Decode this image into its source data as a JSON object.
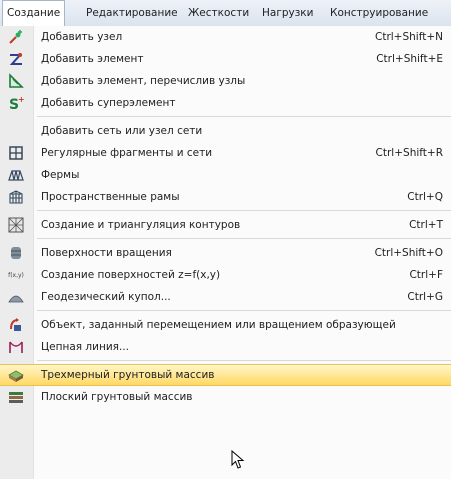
{
  "menubar": {
    "items": [
      {
        "label": "Создание",
        "active": true
      },
      {
        "label": "Редактирование"
      },
      {
        "label": "Жесткости"
      },
      {
        "label": "Нагрузки"
      },
      {
        "label": "Конструирование"
      }
    ]
  },
  "menu": {
    "items": [
      {
        "label": "Добавить узел",
        "shortcut": "Ctrl+Shift+N",
        "icon": "add-node-icon"
      },
      {
        "label": "Добавить элемент",
        "shortcut": "Ctrl+Shift+E",
        "icon": "add-element-icon"
      },
      {
        "label": "Добавить элемент, перечислив узлы",
        "shortcut": "",
        "icon": "add-element-by-nodes-icon"
      },
      {
        "label": "Добавить суперэлемент",
        "shortcut": "",
        "icon": "superelement-icon"
      },
      {
        "label": "Добавить сеть или узел сети",
        "shortcut": "",
        "icon": ""
      },
      {
        "label": "Регулярные фрагменты и сети",
        "shortcut": "Ctrl+Shift+R",
        "icon": "regular-fragments-icon"
      },
      {
        "label": "Фермы",
        "shortcut": "",
        "icon": "truss-icon"
      },
      {
        "label": "Пространственные рамы",
        "shortcut": "Ctrl+Q",
        "icon": "spatial-frame-icon"
      },
      {
        "label": "Создание и триангуляция контуров",
        "shortcut": "Ctrl+T",
        "icon": "triangulation-icon"
      },
      {
        "label": "Поверхности вращения",
        "shortcut": "Ctrl+Shift+O",
        "icon": "surface-of-revolution-icon"
      },
      {
        "label": "Создание поверхностей z=f(x,y)",
        "shortcut": "Ctrl+F",
        "icon": "function-surface-icon",
        "icon_text": "f(x,y)"
      },
      {
        "label": "Геодезический купол...",
        "shortcut": "Ctrl+G",
        "icon": "geodesic-dome-icon"
      },
      {
        "label": "Объект, заданный перемещением или вращением образующей",
        "shortcut": "",
        "icon": "generatrix-object-icon"
      },
      {
        "label": "Цепная линия...",
        "shortcut": "",
        "icon": "catenary-icon"
      },
      {
        "label": "Трехмерный грунтовый массив",
        "shortcut": "",
        "icon": "soil-3d-icon",
        "highlighted": true
      },
      {
        "label": "Плоский грунтовый массив",
        "shortcut": "",
        "icon": "soil-plane-icon"
      }
    ]
  },
  "colors": {
    "highlight_top": "#fff6c8",
    "highlight_bottom": "#ffd965",
    "gutter": "#ececec",
    "menubar": "#dbe3ee"
  }
}
